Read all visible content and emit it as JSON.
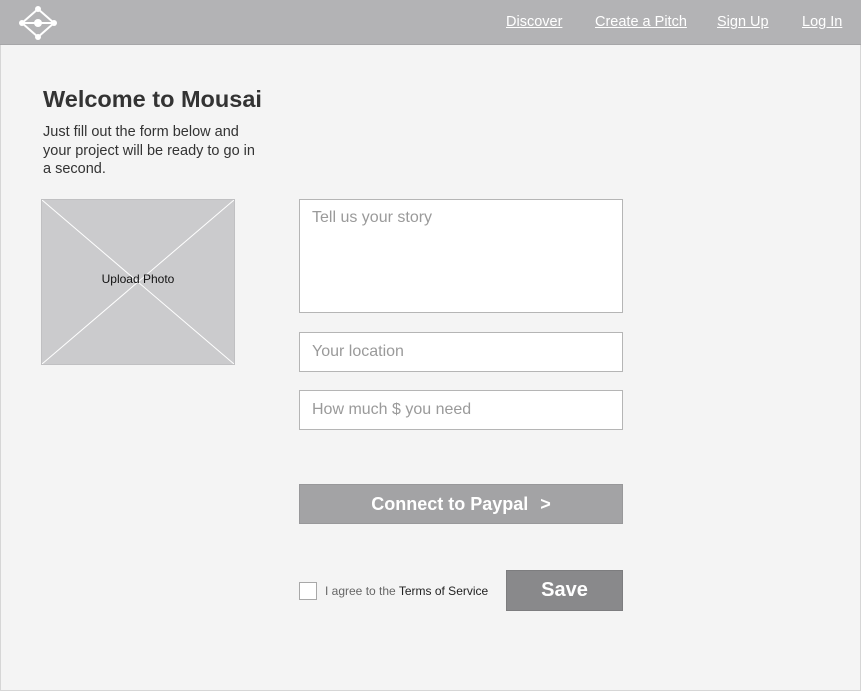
{
  "nav": {
    "discover": "Discover",
    "create_pitch": "Create a Pitch",
    "sign_up": "Sign Up",
    "log_in": "Log In"
  },
  "page": {
    "title": "Welcome to Mousai",
    "intro": "Just fill out the form below and your project will be ready to go in a second."
  },
  "upload": {
    "label": "Upload Photo"
  },
  "form": {
    "story_placeholder": "Tell us your story",
    "location_placeholder": "Your location",
    "amount_placeholder": "How much $ you need",
    "paypal_label": "Connect to Paypal",
    "paypal_chevron": ">",
    "agree_prefix": "I agree to the ",
    "terms_link": "Terms of Service",
    "save_label": "Save"
  },
  "icons": {
    "logo": "network-logo-icon"
  },
  "colors": {
    "navbar": "#b3b3b5",
    "paypal_button": "#a3a3a5",
    "save_button": "#89898b",
    "upload_placeholder": "#cbcbcd"
  }
}
